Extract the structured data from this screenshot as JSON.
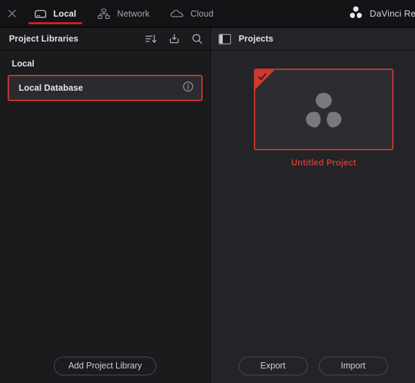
{
  "window": {
    "close_icon": "close-icon",
    "brand_name": "DaVinci Res",
    "brand_logo": "davinci-resolve-logo"
  },
  "tabs": [
    {
      "label": "Local",
      "icon": "hard-drive-icon",
      "active": true
    },
    {
      "label": "Network",
      "icon": "network-icon",
      "active": false
    },
    {
      "label": "Cloud",
      "icon": "cloud-icon",
      "active": false
    }
  ],
  "left_panel": {
    "title": "Project Libraries",
    "header_icons": [
      "sort-descending-icon",
      "import-library-icon",
      "search-icon"
    ],
    "group_label": "Local",
    "items": [
      {
        "name": "Local Database",
        "info_icon": "info-icon",
        "selected": true
      }
    ],
    "footer_buttons": [
      {
        "label": "Add Project Library"
      }
    ]
  },
  "right_panel": {
    "toggle_icon": "panel-toggle-icon",
    "title": "Projects",
    "projects": [
      {
        "name": "Untitled Project",
        "thumbnail_icon": "davinci-resolve-logo",
        "current": true,
        "badge_icon": "check-icon"
      }
    ],
    "footer_buttons": [
      {
        "label": "Export"
      },
      {
        "label": "Import"
      }
    ]
  },
  "colors": {
    "accent_red": "#cc2222",
    "selection_red": "#c0392f",
    "project_label_red": "#c23b32",
    "header_bg": "#131316",
    "left_pane_bg": "#1b1b1e",
    "right_pane_bg": "#232328"
  }
}
